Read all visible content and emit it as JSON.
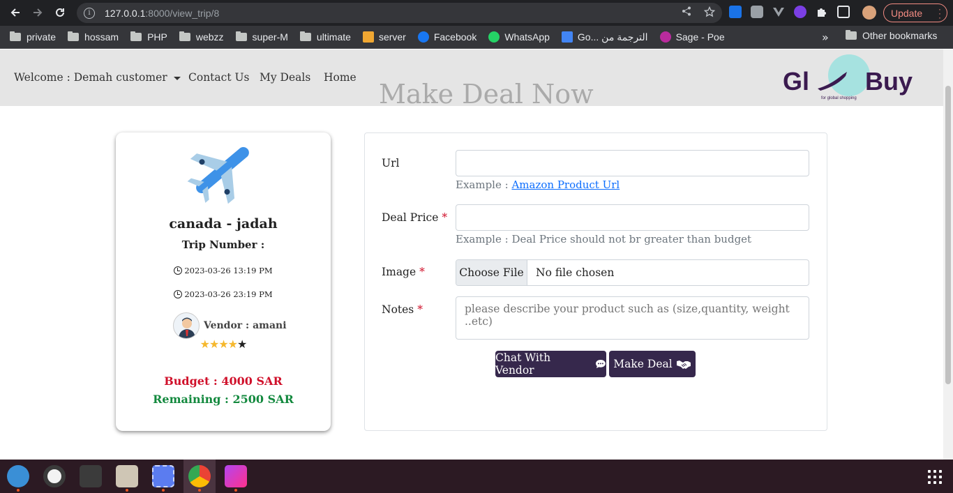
{
  "browser": {
    "url_host": "127.0.0.1",
    "url_rest": ":8000/view_trip/8",
    "update_label": "Update",
    "bookmarks": [
      {
        "label": "private",
        "type": "folder"
      },
      {
        "label": "hossam",
        "type": "folder"
      },
      {
        "label": "PHP",
        "type": "folder"
      },
      {
        "label": "webzz",
        "type": "folder"
      },
      {
        "label": "super-M",
        "type": "folder"
      },
      {
        "label": "ultimate",
        "type": "folder"
      },
      {
        "label": "server",
        "type": "site"
      },
      {
        "label": "Facebook",
        "type": "site"
      },
      {
        "label": "WhatsApp",
        "type": "site"
      },
      {
        "label": "Go... الترجمة من",
        "type": "site"
      },
      {
        "label": "Sage - Poe",
        "type": "site"
      }
    ],
    "other_bookmarks": "Other bookmarks"
  },
  "nav": {
    "welcome": "Welcome : Demah customer",
    "contact": "Contact Us",
    "deals": "My Deals",
    "home": "Home",
    "heading": "Make Deal Now",
    "logo_text_left": "Gl",
    "logo_text_right": "Buy",
    "logo_tagline": "for global shopping"
  },
  "trip": {
    "route": "canada - jadah",
    "trip_number_label": "Trip Number :",
    "departure": "2023-03-26 13:19 PM",
    "arrival": "2023-03-26 23:19 PM",
    "vendor": "Vendor : amani",
    "rating": 4,
    "rating_max": 5,
    "budget": "Budget : 4000 SAR",
    "remaining": "Remaining : 2500 SAR"
  },
  "form": {
    "url_label": "Url",
    "url_help_prefix": "Example : ",
    "url_help_link": "Amazon Product Url",
    "price_label": "Deal Price",
    "price_help": "Example : Deal Price should not br greater than budget",
    "image_label": "Image",
    "choose_file": "Choose File",
    "no_file": "No file chosen",
    "notes_label": "Notes",
    "notes_placeholder": "please describe your product such as (size,quantity, weight ..etc)",
    "required_mark": "*",
    "chat_button": "Chat With Vendor",
    "deal_button": "Make Deal"
  }
}
